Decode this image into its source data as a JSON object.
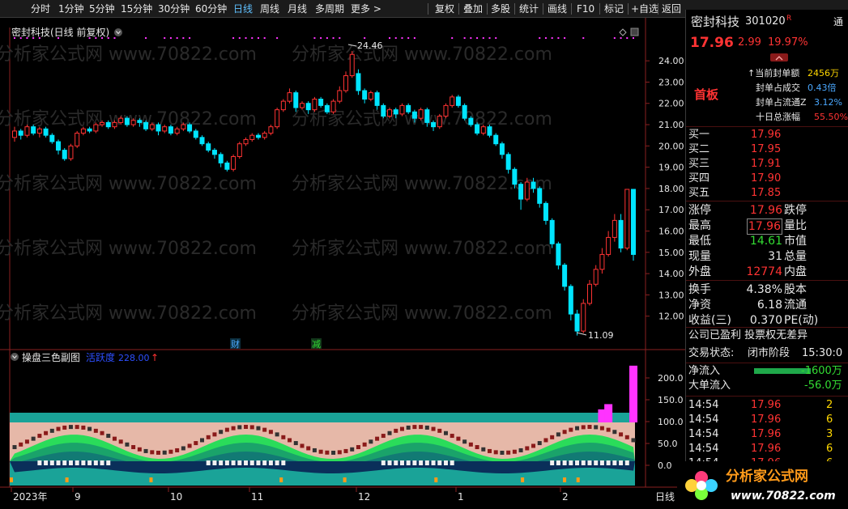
{
  "toolbar": {
    "left_items": [
      "分时",
      "1分钟",
      "5分钟",
      "15分钟",
      "30分钟",
      "60分钟",
      "日线",
      "周线",
      "月线",
      "多周期",
      "更多 >"
    ],
    "active_item": "日线",
    "right_items": [
      "复权",
      "叠加",
      "多股",
      "统计",
      "画线",
      "F10",
      "标记",
      "+自选",
      "返回"
    ]
  },
  "chart": {
    "title": "密封科技(日线 前复权)",
    "high_label": "24.46",
    "low_label": "11.09",
    "marker_cai": "财",
    "marker_jian": "减",
    "price_axis": [
      "24.00",
      "23.00",
      "22.00",
      "21.00",
      "20.00",
      "19.00",
      "18.00",
      "17.00",
      "16.00",
      "15.00",
      "14.00",
      "13.00",
      "12.00"
    ],
    "watermark": "分析家公式网 www.70822.com",
    "indicator_title": "操盘三色副图",
    "indicator_label": "活跃度",
    "indicator_value": "228.00",
    "indicator_arrow": "↑",
    "indicator_axis": [
      "200.0",
      "150.0",
      "100.0",
      "50.0",
      "0.0"
    ],
    "time_axis": [
      "2023年",
      "9",
      "10",
      "11",
      "12",
      "1",
      "2"
    ],
    "period_label": "日线"
  },
  "chart_data": {
    "type": "candlestick",
    "ylim": [
      11,
      24.5
    ],
    "candles": [
      [
        20.4,
        20.7,
        20.2,
        20.9
      ],
      [
        20.7,
        20.5,
        20.3,
        20.8
      ],
      [
        20.5,
        20.9,
        20.4,
        21.0
      ],
      [
        20.9,
        20.6,
        20.5,
        21.0
      ],
      [
        20.6,
        20.8,
        20.4,
        20.9
      ],
      [
        20.8,
        20.5,
        20.4,
        20.9
      ],
      [
        20.5,
        20.2,
        20.1,
        20.6
      ],
      [
        20.2,
        19.8,
        19.6,
        20.3
      ],
      [
        19.8,
        19.4,
        19.3,
        19.9
      ],
      [
        19.4,
        20.0,
        19.3,
        20.1
      ],
      [
        20.0,
        20.6,
        19.9,
        20.7
      ],
      [
        20.6,
        20.8,
        20.5,
        20.9
      ],
      [
        20.8,
        20.7,
        20.6,
        20.9
      ],
      [
        20.7,
        21.0,
        20.6,
        21.1
      ],
      [
        21.0,
        21.1,
        20.9,
        21.2
      ],
      [
        21.1,
        20.9,
        20.8,
        21.2
      ],
      [
        20.9,
        21.1,
        20.8,
        21.2
      ],
      [
        21.1,
        21.3,
        21.0,
        21.4
      ],
      [
        21.3,
        21.0,
        20.9,
        21.4
      ],
      [
        21.0,
        21.2,
        20.9,
        21.3
      ],
      [
        21.2,
        21.1,
        20.9,
        21.3
      ],
      [
        21.1,
        20.8,
        20.7,
        21.2
      ],
      [
        20.8,
        21.0,
        20.7,
        21.1
      ],
      [
        21.0,
        20.7,
        20.5,
        21.1
      ],
      [
        20.7,
        20.9,
        20.6,
        21.0
      ],
      [
        20.9,
        20.6,
        20.5,
        21.0
      ],
      [
        20.6,
        20.8,
        20.5,
        20.9
      ],
      [
        20.8,
        21.0,
        20.7,
        21.1
      ],
      [
        21.0,
        20.7,
        20.6,
        21.1
      ],
      [
        20.7,
        20.4,
        20.3,
        20.8
      ],
      [
        20.4,
        20.1,
        20.0,
        20.5
      ],
      [
        20.1,
        19.8,
        19.7,
        20.2
      ],
      [
        19.8,
        19.6,
        19.4,
        19.9
      ],
      [
        19.6,
        19.2,
        19.0,
        19.7
      ],
      [
        19.2,
        18.9,
        18.8,
        19.3
      ],
      [
        18.9,
        19.5,
        18.8,
        19.6
      ],
      [
        19.5,
        20.1,
        19.4,
        20.2
      ],
      [
        20.1,
        20.3,
        20.0,
        20.4
      ],
      [
        20.3,
        20.5,
        20.2,
        20.6
      ],
      [
        20.5,
        20.4,
        20.3,
        20.6
      ],
      [
        20.4,
        20.6,
        20.3,
        20.7
      ],
      [
        20.6,
        20.9,
        20.5,
        21.0
      ],
      [
        20.9,
        21.7,
        20.8,
        21.8
      ],
      [
        21.7,
        22.1,
        21.6,
        22.2
      ],
      [
        22.1,
        22.5,
        22.0,
        22.7
      ],
      [
        22.5,
        21.8,
        21.6,
        22.6
      ],
      [
        21.8,
        22.0,
        21.7,
        22.1
      ],
      [
        22.0,
        21.7,
        21.5,
        22.1
      ],
      [
        21.7,
        22.2,
        21.6,
        22.3
      ],
      [
        22.2,
        21.9,
        21.8,
        22.3
      ],
      [
        21.9,
        21.6,
        21.5,
        22.0
      ],
      [
        21.6,
        22.1,
        21.5,
        22.2
      ],
      [
        22.1,
        22.6,
        22.0,
        22.8
      ],
      [
        22.6,
        23.3,
        22.5,
        23.5
      ],
      [
        23.3,
        24.3,
        23.2,
        24.46
      ],
      [
        23.4,
        22.6,
        22.4,
        23.6
      ],
      [
        22.6,
        22.2,
        22.0,
        22.7
      ],
      [
        22.2,
        22.5,
        22.1,
        22.6
      ],
      [
        22.5,
        21.9,
        21.7,
        22.6
      ],
      [
        21.9,
        21.4,
        21.3,
        22.0
      ],
      [
        21.4,
        21.7,
        21.3,
        21.8
      ],
      [
        21.7,
        21.5,
        21.3,
        21.8
      ],
      [
        21.5,
        21.9,
        21.4,
        22.0
      ],
      [
        21.9,
        21.6,
        21.5,
        22.0
      ],
      [
        21.6,
        21.3,
        21.1,
        21.7
      ],
      [
        21.3,
        21.7,
        21.2,
        21.8
      ],
      [
        21.7,
        21.1,
        20.9,
        21.8
      ],
      [
        21.1,
        20.9,
        20.7,
        21.2
      ],
      [
        20.9,
        21.4,
        20.8,
        21.5
      ],
      [
        21.4,
        21.9,
        21.3,
        22.0
      ],
      [
        21.9,
        22.3,
        21.8,
        22.4
      ],
      [
        22.3,
        21.9,
        21.8,
        22.4
      ],
      [
        21.9,
        21.3,
        21.2,
        22.0
      ],
      [
        21.3,
        21.0,
        20.9,
        21.4
      ],
      [
        21.0,
        20.6,
        20.5,
        21.1
      ],
      [
        20.6,
        20.9,
        20.5,
        21.0
      ],
      [
        20.9,
        20.5,
        20.4,
        21.0
      ],
      [
        20.5,
        20.1,
        20.0,
        20.6
      ],
      [
        20.1,
        19.6,
        19.4,
        20.2
      ],
      [
        19.6,
        18.9,
        18.7,
        19.7
      ],
      [
        18.9,
        18.2,
        18.0,
        19.0
      ],
      [
        18.2,
        17.5,
        17.0,
        18.3
      ],
      [
        17.5,
        18.3,
        17.4,
        18.5
      ],
      [
        18.3,
        18.0,
        17.8,
        18.5
      ],
      [
        18.0,
        17.3,
        17.1,
        18.1
      ],
      [
        17.3,
        16.5,
        16.3,
        17.4
      ],
      [
        16.5,
        15.4,
        15.2,
        16.6
      ],
      [
        15.4,
        14.4,
        14.2,
        15.5
      ],
      [
        14.4,
        13.4,
        13.2,
        14.5
      ],
      [
        13.4,
        12.1,
        11.8,
        13.5
      ],
      [
        12.1,
        11.3,
        11.09,
        12.3
      ],
      [
        11.3,
        12.6,
        11.2,
        12.8
      ],
      [
        12.6,
        13.5,
        12.5,
        13.7
      ],
      [
        13.5,
        14.2,
        13.4,
        14.4
      ],
      [
        14.2,
        14.9,
        14.0,
        15.2
      ],
      [
        14.9,
        15.7,
        14.8,
        16.0
      ],
      [
        15.7,
        16.5,
        15.5,
        16.8
      ],
      [
        16.5,
        15.2,
        15.0,
        16.8
      ],
      [
        15.2,
        17.96,
        15.1,
        17.96
      ],
      [
        17.96,
        14.9,
        14.61,
        17.96
      ]
    ],
    "indicator_bars": [
      0,
      0,
      0,
      0,
      0,
      0,
      0,
      0,
      0,
      0,
      0,
      0,
      0,
      0,
      0,
      0,
      0,
      0,
      0,
      0,
      0,
      0,
      0,
      0,
      0,
      0,
      0,
      0,
      0,
      0,
      0,
      0,
      0,
      0,
      0,
      0,
      0,
      0,
      0,
      0,
      0,
      0,
      0,
      0,
      0,
      0,
      0,
      0,
      0,
      0,
      0,
      0,
      0,
      0,
      0,
      0,
      0,
      0,
      0,
      0,
      0,
      0,
      0,
      0,
      0,
      0,
      0,
      0,
      0,
      0,
      0,
      0,
      0,
      0,
      0,
      0,
      0,
      0,
      0,
      0,
      0,
      0,
      0,
      0,
      0,
      0,
      0,
      0,
      0,
      0,
      0,
      0,
      0,
      0,
      128,
      140,
      0,
      0,
      0,
      228
    ]
  },
  "panel": {
    "stock_name": "密封科技",
    "stock_code": "301020",
    "code_flag": "R",
    "price": "17.96",
    "change": "2.99",
    "change_pct": "19.97%",
    "tag": "首板",
    "stats": [
      {
        "label": "↑当前封单额",
        "value": "2456万"
      },
      {
        "label": "封单占成交",
        "value": "0.43倍"
      },
      {
        "label": "封单占流通Z",
        "value": "3.12%"
      },
      {
        "label": "十日总涨幅",
        "value": "55.50%"
      }
    ],
    "bids": [
      {
        "label": "买一",
        "price": "17.96"
      },
      {
        "label": "买二",
        "price": "17.95"
      },
      {
        "label": "买三",
        "price": "17.91"
      },
      {
        "label": "买四",
        "price": "17.90"
      },
      {
        "label": "买五",
        "price": "17.85"
      }
    ],
    "quote": [
      {
        "l1": "涨停",
        "v1": "17.96",
        "l2": "跌停"
      },
      {
        "l1": "最高",
        "v1": "17.96",
        "l2": "量比"
      },
      {
        "l1": "最低",
        "v1": "14.61",
        "l2": "市值"
      },
      {
        "l1": "现量",
        "v1": "31",
        "l2": "总量"
      },
      {
        "l1": "外盘",
        "v1": "12774",
        "l2": "内盘"
      }
    ],
    "quote2": [
      {
        "l1": "换手",
        "v1": "4.38%",
        "l2": "股本"
      },
      {
        "l1": "净资",
        "v1": "6.18",
        "l2": "流通"
      },
      {
        "l1": "收益(三)",
        "v1": "0.370",
        "l2": "PE(动)"
      }
    ],
    "notice": "公司已盈利 投票权无差异",
    "trade_status_label": "交易状态:",
    "trade_status_value": "闭市阶段",
    "trade_time": "15:30:0",
    "net_inflow_label": "净流入",
    "net_inflow_value": "-1600万",
    "big_inflow_label": "大单流入",
    "big_inflow_value": "-56.0万",
    "ticks": [
      {
        "time": "14:54",
        "price": "17.96",
        "vol": "2"
      },
      {
        "time": "14:54",
        "price": "17.96",
        "vol": "6"
      },
      {
        "time": "14:54",
        "price": "17.96",
        "vol": "3"
      },
      {
        "time": "14:54",
        "price": "17.96",
        "vol": "6"
      },
      {
        "time": "14:54",
        "price": "17.96",
        "vol": "6"
      }
    ]
  },
  "logo": {
    "name": "分析家公式网",
    "url": "www.70822.com"
  },
  "colors": {
    "up": "#ff3333",
    "down": "#00e5ff",
    "magenta": "#ff33ff",
    "teal": "#1aa398",
    "axis": "#8a2020"
  }
}
